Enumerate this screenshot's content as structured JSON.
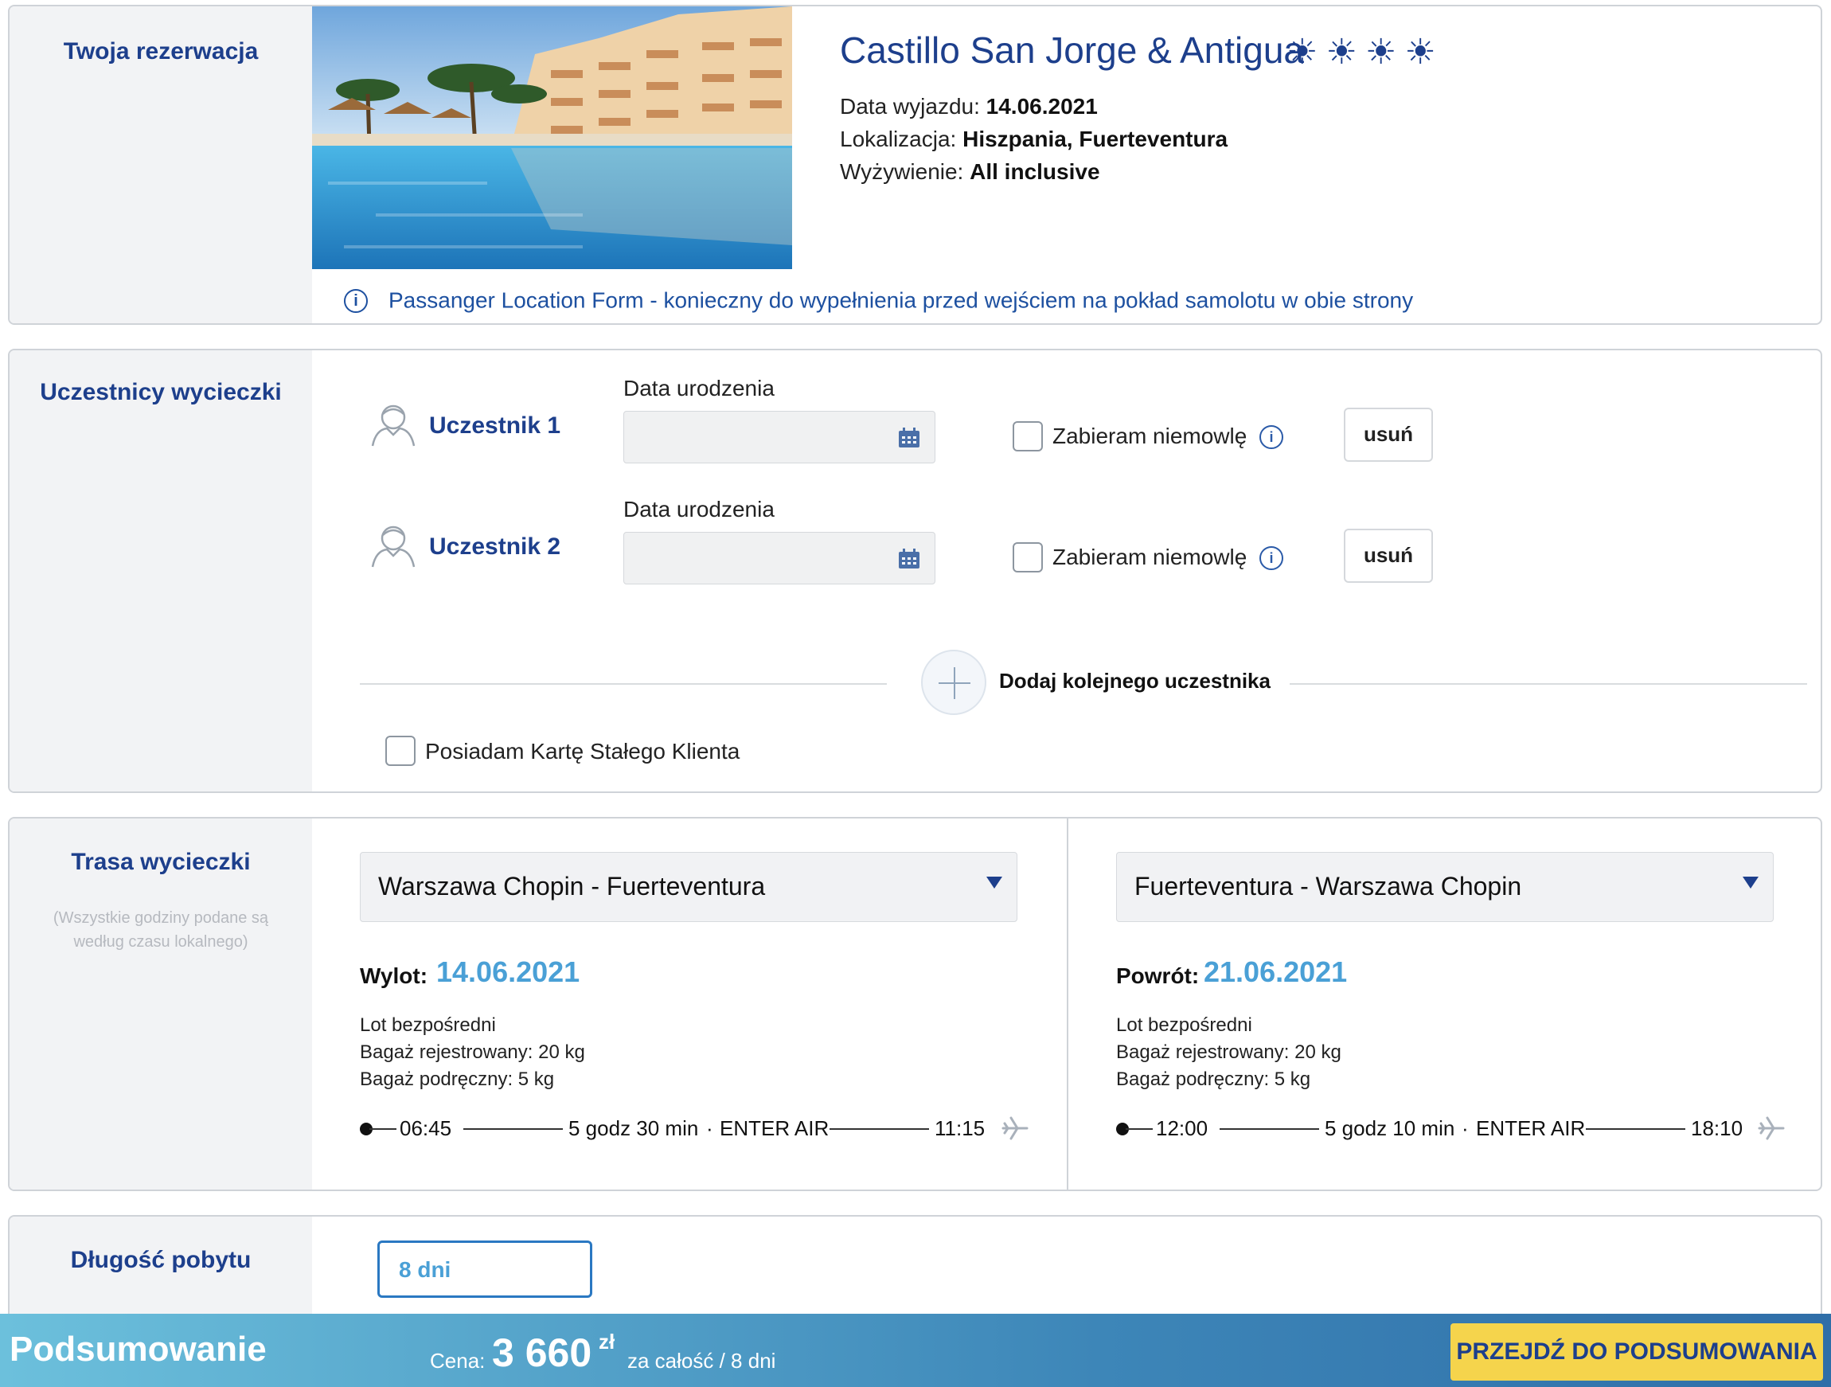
{
  "reservation": {
    "section_title": "Twoja rezerwacja",
    "hotel_name": "Castillo San Jorge & Antigua",
    "rating_icons": "☀☀☀☀",
    "departure_label": "Data wyjazdu:",
    "departure_value": "14.06.2021",
    "location_label": "Lokalizacja:",
    "location_value": "Hiszpania, Fuerteventura",
    "board_label": "Wyżywienie:",
    "board_value": "All inclusive",
    "plf_notice": "Passanger Location Form - konieczny do wypełnienia przed wejściem na pokład samolotu w obie strony"
  },
  "participants": {
    "section_title": "Uczestnicy wycieczki",
    "items": [
      {
        "name": "Uczestnik 1",
        "dob_label": "Data urodzenia",
        "dob_value": "",
        "infant_label": "Zabieram niemowlę",
        "remove_label": "usuń"
      },
      {
        "name": "Uczestnik 2",
        "dob_label": "Data urodzenia",
        "dob_value": "",
        "infant_label": "Zabieram niemowlę",
        "remove_label": "usuń"
      }
    ],
    "add_label": "Dodaj kolejnego uczestnika",
    "loyalty_label": "Posiadam Kartę Stałego Klienta"
  },
  "route": {
    "section_title": "Trasa wycieczki",
    "note": "(Wszystkie godziny podane są według czasu lokalnego)",
    "outbound": {
      "route": "Warszawa Chopin - Fuerteventura",
      "date_label": "Wylot:",
      "date": "14.06.2021",
      "type": "Lot bezpośredni",
      "checked_bag": "Bagaż rejestrowany: 20 kg",
      "cabin_bag": "Bagaż podręczny: 5 kg",
      "dep_time": "06:45",
      "duration": "5 godz 30 min",
      "sep": "·",
      "airline": "ENTER AIR",
      "arr_time": "11:15"
    },
    "return": {
      "route": "Fuerteventura - Warszawa Chopin",
      "date_label": "Powrót:",
      "date": "21.06.2021",
      "type": "Lot bezpośredni",
      "checked_bag": "Bagaż rejestrowany: 20 kg",
      "cabin_bag": "Bagaż podręczny: 5 kg",
      "dep_time": "12:00",
      "duration": "5 godz 10 min",
      "sep": "·",
      "airline": "ENTER AIR",
      "arr_time": "18:10"
    }
  },
  "stay": {
    "section_title": "Długość pobytu",
    "value": "8 dni"
  },
  "footer": {
    "title": "Podsumowanie",
    "price_label": "Cena:",
    "price": "3 660",
    "currency": "zł",
    "price_suffix": "za całość / 8 dni",
    "cta": "PRZEJDŹ DO PODSUMOWANIA"
  },
  "colors": {
    "brand": "#1d3f8c",
    "accent": "#4aa0d6",
    "cta": "#f5d44c"
  }
}
